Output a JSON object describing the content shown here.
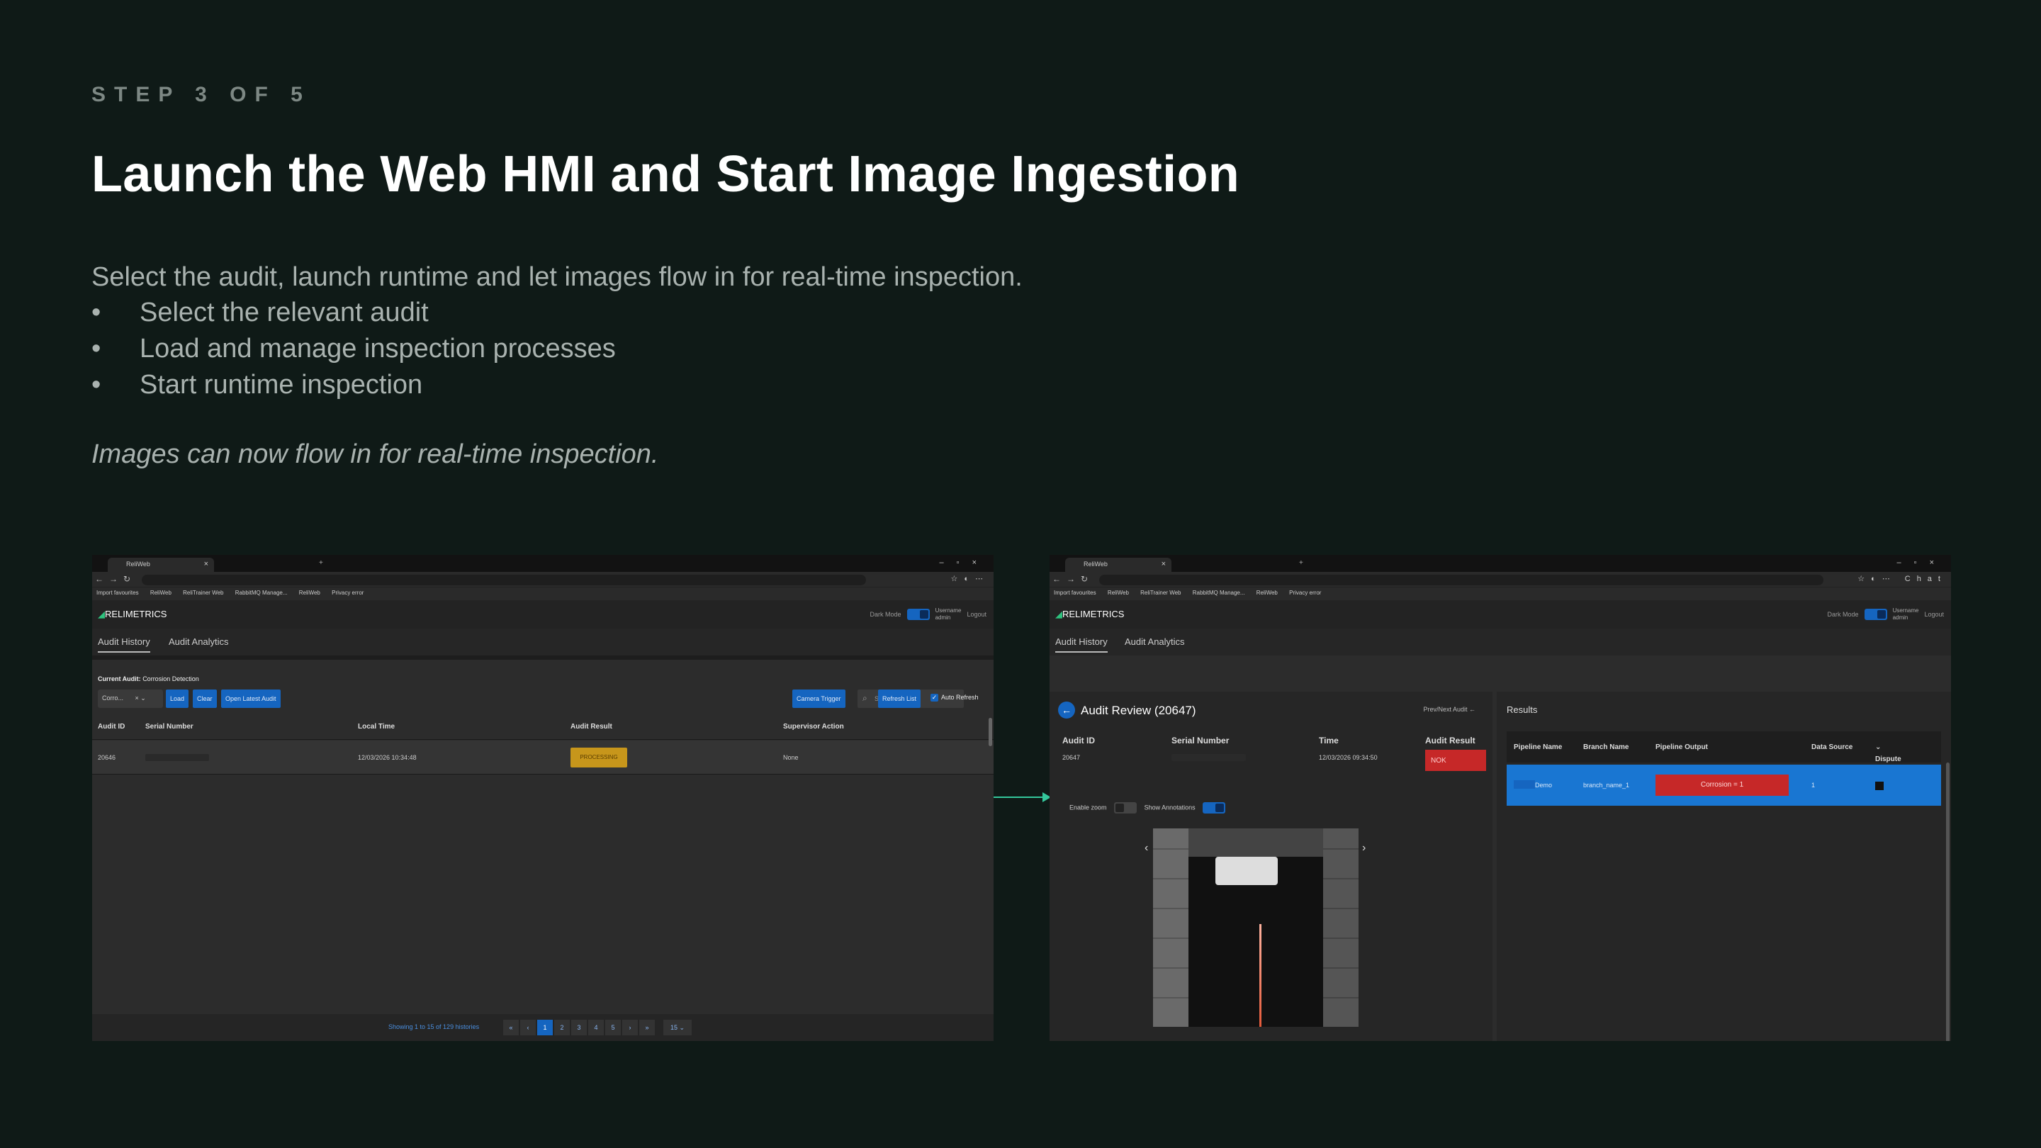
{
  "slide": {
    "step": "STEP 3 OF 5",
    "title": "Launch the Web HMI and Start Image Ingestion",
    "intro": "Select the audit, launch runtime and let images flow in for real-time inspection.",
    "bullets": [
      "Select the relevant audit",
      "Load and manage inspection processes",
      "Start runtime inspection"
    ],
    "note": "Images can now flow in for real-time inspection."
  },
  "browser": {
    "tab_label": "ReliWeb",
    "bookmarks": [
      "Import favourites",
      "ReliWeb",
      "ReliTrainer Web",
      "RabbitMQ Manage...",
      "ReliWeb",
      "Privacy error"
    ],
    "chat_label": "Chat"
  },
  "app": {
    "logo": "RELIMETRICS",
    "dark_mode_label": "Dark Mode",
    "username_label": "Username",
    "username": "admin",
    "logout_label": "Logout",
    "tabs": [
      "Audit History",
      "Audit Analytics"
    ]
  },
  "history": {
    "current_audit_label": "Current Audit:",
    "current_audit_value": "Corrosion Detection",
    "select_value": "Corro...",
    "load_btn": "Load",
    "clear_btn": "Clear",
    "open_latest_btn": "Open Latest Audit",
    "camera_trigger_btn": "Camera Trigger",
    "search_placeholder": "Search Audit",
    "refresh_btn": "Refresh List",
    "auto_refresh_label": "Auto Refresh",
    "columns": [
      "Audit ID",
      "Serial Number",
      "Local Time",
      "Audit Result",
      "Supervisor Action"
    ],
    "row": {
      "audit_id": "20646",
      "local_time": "12/03/2026 10:34:48",
      "audit_result": "PROCESSING",
      "supervisor_action": "None"
    },
    "pagination_text": "Showing 1 to 15 of 129 histories",
    "pages": [
      "1",
      "2",
      "3",
      "4",
      "5"
    ],
    "page_size": "15"
  },
  "review": {
    "title": "Audit Review (20647)",
    "prev_next_label": "Prev/Next Audit",
    "headers": [
      "Audit ID",
      "Serial Number",
      "Time",
      "Audit Result"
    ],
    "audit_id": "20647",
    "time": "12/03/2026 09:34:50",
    "audit_result": "NOK",
    "enable_zoom_label": "Enable zoom",
    "show_annotations_label": "Show Annotations",
    "results_label": "Results",
    "result_columns": [
      "Pipeline Name",
      "Branch Name",
      "Pipeline Output",
      "Data Source",
      "Dispute"
    ],
    "result_row": {
      "pipeline_name": "Demo",
      "branch_name": "branch_name_1",
      "pipeline_output": "Corrosion = 1",
      "data_source": "1"
    }
  }
}
